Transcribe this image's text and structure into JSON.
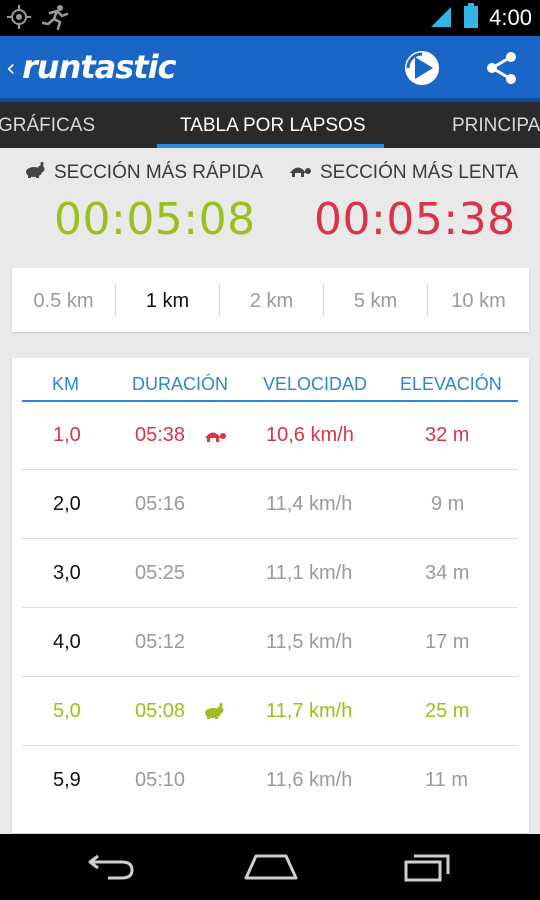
{
  "status_bar": {
    "time": "4:00",
    "icons": [
      "gps-icon",
      "runner-icon",
      "signal-icon",
      "battery-icon"
    ]
  },
  "action_bar": {
    "logo_text": "runtastic",
    "icons": [
      "back-chevron-icon",
      "runtastic-play-icon",
      "share-icon"
    ]
  },
  "tabs": [
    {
      "label": "GRÁFICAS",
      "active": false
    },
    {
      "label": "TABLA POR LAPSOS",
      "active": true
    },
    {
      "label": "PRINCIPA",
      "active": false
    }
  ],
  "summary": {
    "fastest": {
      "label": "SECCIÓN MÁS RÁPIDA",
      "time": "00:05:08",
      "icon": "rabbit-icon"
    },
    "slowest": {
      "label": "SECCIÓN MÁS LENTA",
      "time": "00:05:38",
      "icon": "turtle-icon"
    }
  },
  "segments": [
    {
      "label": "0.5 km",
      "active": false
    },
    {
      "label": "1 km",
      "active": true
    },
    {
      "label": "2 km",
      "active": false
    },
    {
      "label": "5 km",
      "active": false
    },
    {
      "label": "10 km",
      "active": false
    }
  ],
  "table": {
    "headers": [
      "KM",
      "DURACIÓN",
      "VELOCIDAD",
      "ELEVACIÓN"
    ],
    "rows": [
      {
        "km": "1,0",
        "duration": "05:38",
        "speed": "10,6 km/h",
        "elevation": "32 m",
        "highlight": "slowest"
      },
      {
        "km": "2,0",
        "duration": "05:16",
        "speed": "11,4 km/h",
        "elevation": "9 m",
        "highlight": ""
      },
      {
        "km": "3,0",
        "duration": "05:25",
        "speed": "11,1 km/h",
        "elevation": "34 m",
        "highlight": ""
      },
      {
        "km": "4,0",
        "duration": "05:12",
        "speed": "11,5 km/h",
        "elevation": "17 m",
        "highlight": ""
      },
      {
        "km": "5,0",
        "duration": "05:08",
        "speed": "11,7 km/h",
        "elevation": "25 m",
        "highlight": "fastest"
      },
      {
        "km": "5,9",
        "duration": "05:10",
        "speed": "11,6 km/h",
        "elevation": "11 m",
        "highlight": ""
      }
    ]
  },
  "colors": {
    "action_bar": "#1a66c7",
    "tab_indicator": "#2a8ae0",
    "header_blue": "#2e85d6",
    "fastest_green": "#9bbf1d",
    "slowest_red": "#d8344a",
    "muted_text": "#9a9a9a"
  },
  "nav_bar": {
    "icons": [
      "back-icon",
      "home-icon",
      "recent-apps-icon"
    ]
  }
}
